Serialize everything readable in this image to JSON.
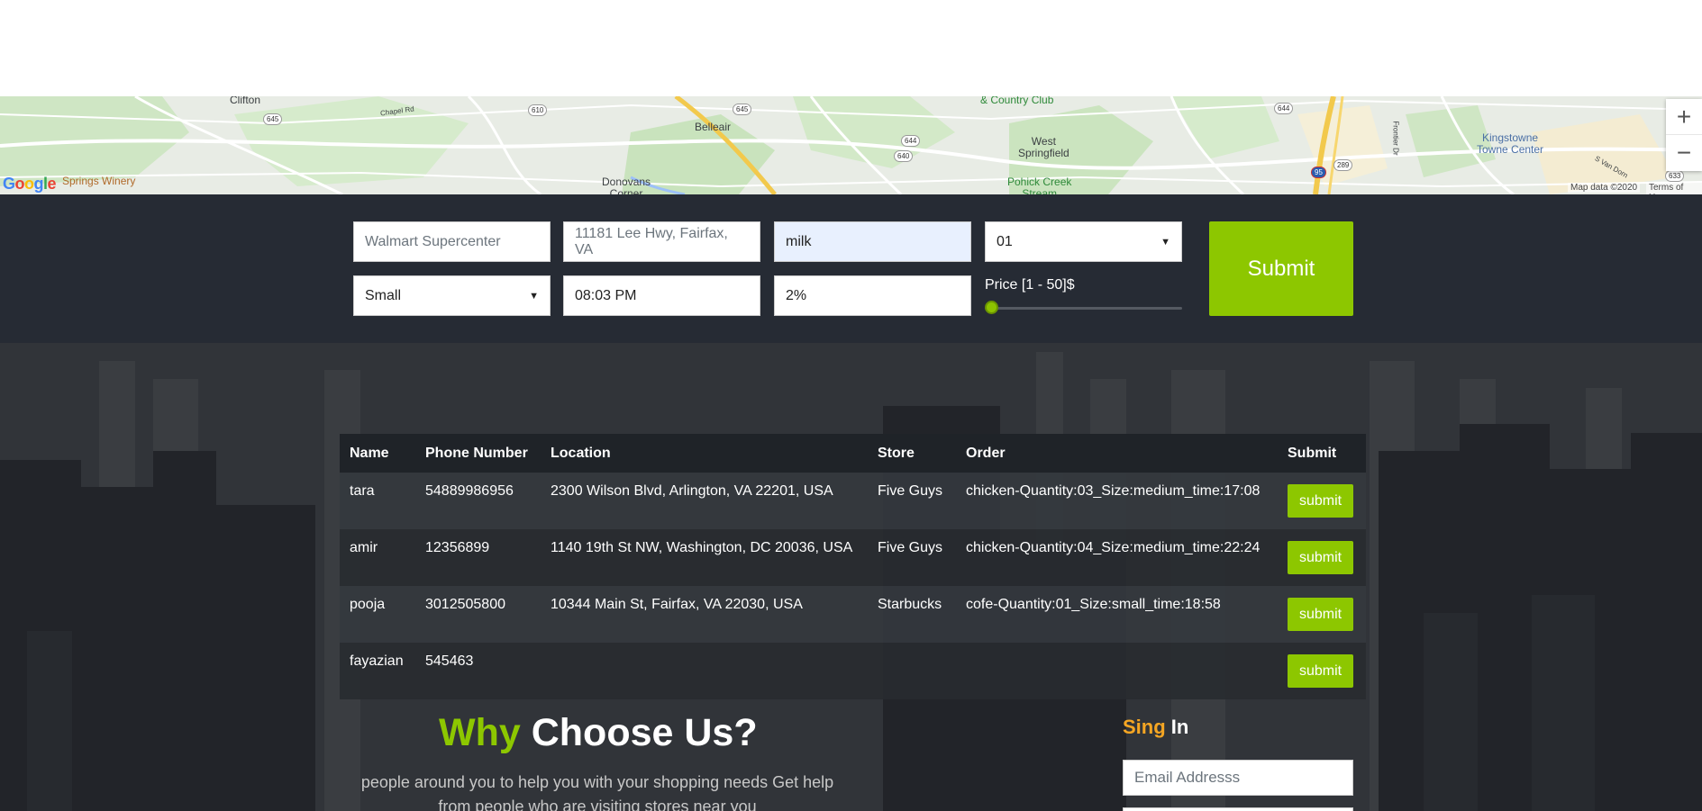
{
  "map": {
    "places": {
      "clifton": "Clifton",
      "country_club": "& Country Club",
      "belleair": "Belleair",
      "west_springfield": "West\nSpringfield",
      "kingstowne": "Kingstowne\nTowne Center",
      "donovans_corner": "Donovans\nCorner",
      "pohick_creek": "Pohick Creek\nStream",
      "springs_winery": "Springs Winery",
      "chapel_rd": "Chapel Rd",
      "frontier_dr": "Frontier Dr",
      "van_dorn": "S Van Dorn"
    },
    "shields": [
      "645",
      "610",
      "645",
      "644",
      "640",
      "644",
      "289",
      "95",
      "633"
    ],
    "logo": [
      "G",
      "o",
      "o",
      "g",
      "l",
      "e"
    ],
    "map_data": "Map data ©2020",
    "terms": "Terms of Use",
    "zoom_in": "+",
    "zoom_out": "−"
  },
  "form": {
    "store_placeholder": "Walmart Supercenter",
    "address_placeholder": "11181 Lee Hwy, Fairfax, VA",
    "item_value": "milk",
    "quantity_value": "01",
    "size_value": "Small",
    "time_value": "08:03 PM",
    "note_value": "2%",
    "price_label": "Price [1 - 50]$",
    "price_value": 1,
    "submit_label": "Submit"
  },
  "orders": {
    "headers": [
      "Name",
      "Phone Number",
      "Location",
      "Store",
      "Order",
      "Submit"
    ],
    "rows": [
      {
        "name": "tara",
        "phone": "54889986956",
        "location": "2300 Wilson Blvd, Arlington, VA 22201, USA",
        "store": "Five Guys",
        "order": "chicken-Quantity:03_Size:medium_time:17:08",
        "button": "submit"
      },
      {
        "name": "amir",
        "phone": "12356899",
        "location": "1140 19th St NW, Washington, DC 20036, USA",
        "store": "Five Guys",
        "order": "chicken-Quantity:04_Size:medium_time:22:24",
        "button": "submit"
      },
      {
        "name": "pooja",
        "phone": "3012505800",
        "location": "10344 Main St, Fairfax, VA 22030, USA",
        "store": "Starbucks",
        "order": "cofe-Quantity:01_Size:small_time:18:58",
        "button": "submit"
      },
      {
        "name": "fayazian",
        "phone": "545463",
        "location": "",
        "store": "",
        "order": "",
        "button": "submit"
      }
    ]
  },
  "why": {
    "title_accent": "Why",
    "title_rest": "Choose Us?",
    "description": "people around you to help you with your shopping needs Get help from people who are visiting stores near you"
  },
  "signin": {
    "title_accent": "Sing",
    "title_rest": "In",
    "email_placeholder": "Email Addresss"
  },
  "colors": {
    "accent_green": "#8dc700",
    "accent_orange": "#f5a623",
    "form_bar": "#262b34"
  }
}
